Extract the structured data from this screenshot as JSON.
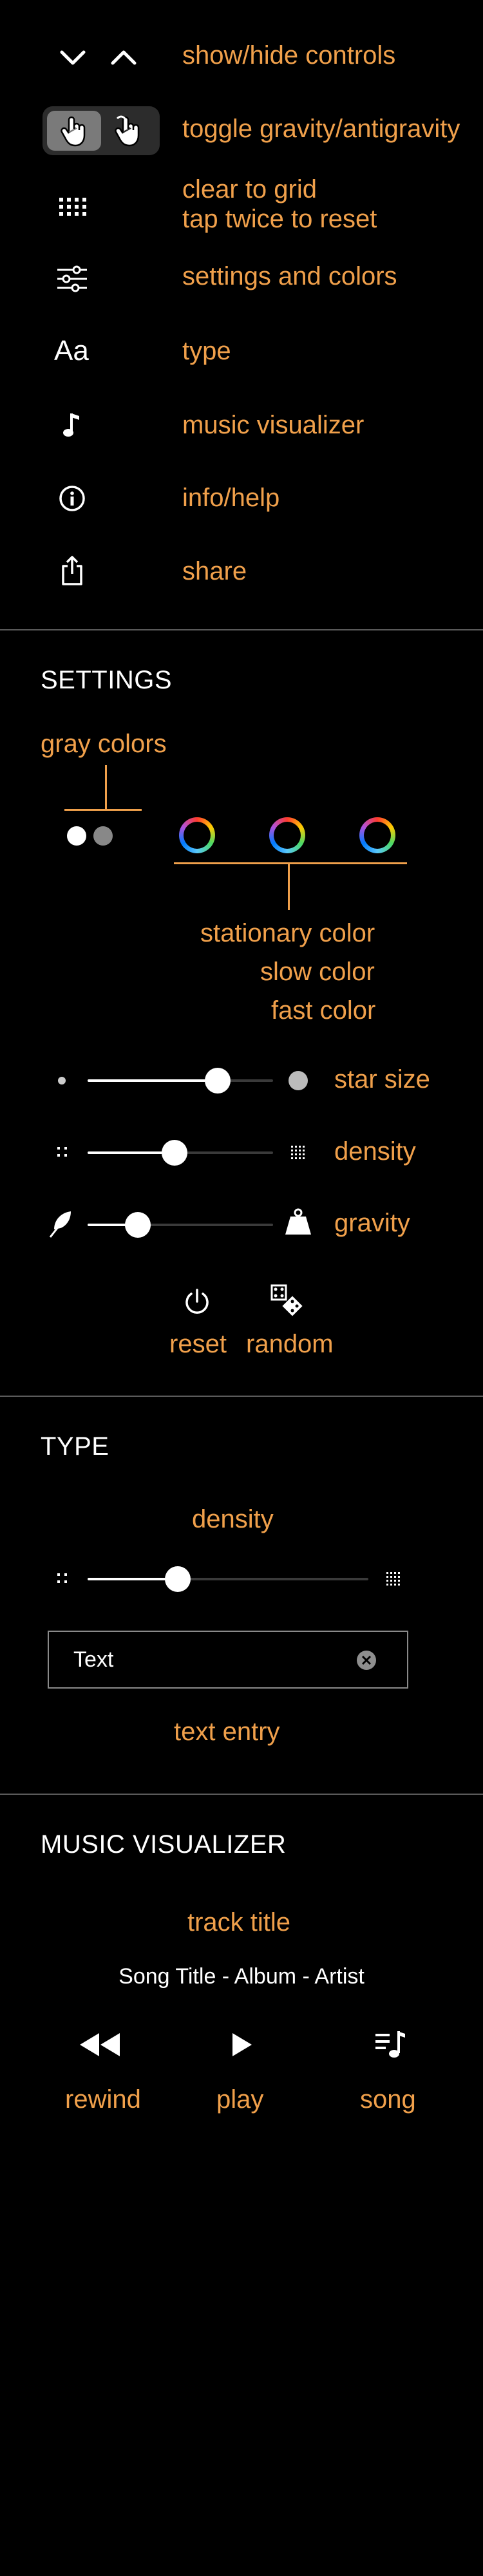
{
  "legend": {
    "items": [
      {
        "icon": "chevron-down-up-icon",
        "label": "show/hide controls"
      },
      {
        "icon": "gravity-toggle-icon",
        "label": "toggle gravity/antigravity"
      },
      {
        "icon": "grid-icon",
        "label_line1": "clear to grid",
        "label_line2": "tap twice to reset"
      },
      {
        "icon": "sliders-icon",
        "label": "settings and colors"
      },
      {
        "icon": "type-icon",
        "glyph": "Aa",
        "label": "type"
      },
      {
        "icon": "music-note-icon",
        "label": "music visualizer"
      },
      {
        "icon": "info-icon",
        "label": "info/help"
      },
      {
        "icon": "share-icon",
        "label": "share"
      }
    ]
  },
  "settings": {
    "title": "SETTINGS",
    "gray_colors_label": "gray colors",
    "stationary_color_label": "stationary color",
    "slow_color_label": "slow color",
    "fast_color_label": "fast color",
    "sliders": [
      {
        "name": "star size",
        "value": 0.7
      },
      {
        "name": "density",
        "value": 0.47
      },
      {
        "name": "gravity",
        "value": 0.27
      }
    ],
    "reset_label": "reset",
    "random_label": "random"
  },
  "type_section": {
    "title": "TYPE",
    "density_label": "density",
    "density_value": 0.32,
    "text_value": "Text",
    "text_entry_label": "text entry"
  },
  "music": {
    "title": "MUSIC VISUALIZER",
    "track_title_label": "track title",
    "track_text": "Song Title - Album - Artist",
    "rewind_label": "rewind",
    "play_label": "play",
    "song_label": "song"
  },
  "colors": {
    "accent": "#f0a04b",
    "background": "#000000",
    "divider": "#5a5a5a"
  }
}
